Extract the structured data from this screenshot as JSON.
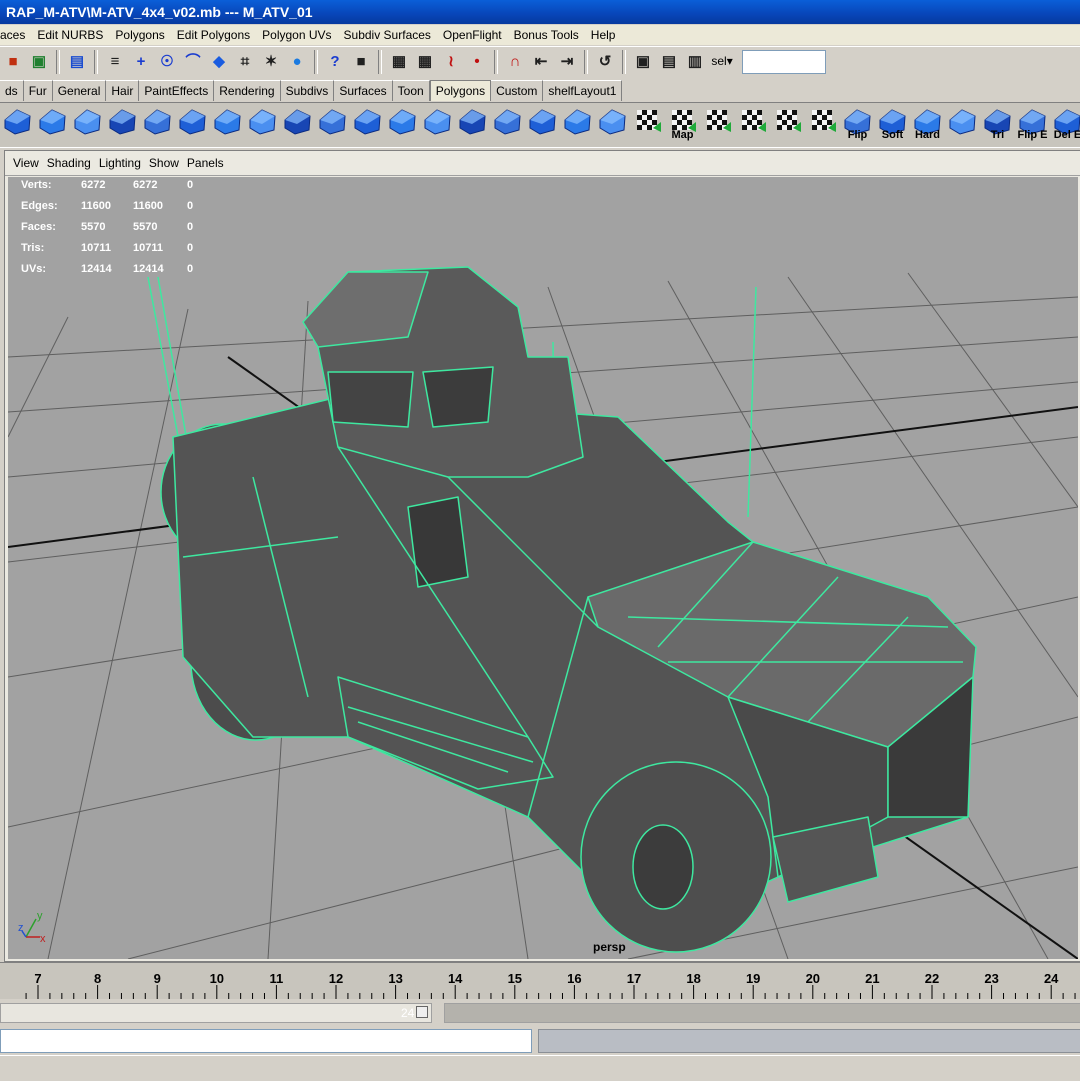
{
  "window": {
    "title": "RAP_M-ATV\\M-ATV_4x4_v02.mb   ---   M_ATV_01"
  },
  "menubar": {
    "items": [
      "aces",
      "Edit NURBS",
      "Polygons",
      "Edit Polygons",
      "Polygon UVs",
      "Subdiv Surfaces",
      "OpenFlight",
      "Bonus Tools",
      "Help"
    ]
  },
  "toolbar": {
    "icons": [
      "select-by-hierarchy-icon",
      "select-by-object-icon",
      "select-by-component-icon",
      "snap-menu-icon",
      "move-icon",
      "lasso-icon",
      "curve-icon",
      "cube-icon",
      "lattice-icon",
      "particle-icon",
      "sphere-icon",
      "help-icon",
      "lock-icon",
      "selection-mask-icon",
      "grid-snap-icon",
      "curve-snap-icon",
      "point-snap-icon",
      "magnet-snap-icon",
      "input-ops-icon",
      "output-ops-icon",
      "history-icon",
      "render-icon",
      "ipr-render-icon",
      "render-settings-icon"
    ],
    "sel_label": "sel",
    "sel_value": ""
  },
  "shelf_tabs": {
    "tabs": [
      "ds",
      "Fur",
      "General",
      "Hair",
      "PaintEffects",
      "Rendering",
      "Subdivs",
      "Surfaces",
      "Toon",
      "Polygons",
      "Custom",
      "shelfLayout1"
    ],
    "active": "Polygons"
  },
  "shelf": {
    "icons": [
      {
        "name": "poly-sphere-icon",
        "label": ""
      },
      {
        "name": "poly-cylinder-icon",
        "label": ""
      },
      {
        "name": "poly-cube-wire-icon",
        "label": ""
      },
      {
        "name": "extrude-face-icon",
        "label": ""
      },
      {
        "name": "split-polygon-icon",
        "label": ""
      },
      {
        "name": "extrude-edge-icon",
        "label": ""
      },
      {
        "name": "bevel-icon",
        "label": ""
      },
      {
        "name": "wedge-face-icon",
        "label": ""
      },
      {
        "name": "poke-face-icon",
        "label": ""
      },
      {
        "name": "append-polygon-icon",
        "label": ""
      },
      {
        "name": "merge-vertices-icon",
        "label": ""
      },
      {
        "name": "collapse-icon",
        "label": ""
      },
      {
        "name": "subdivide-icon",
        "label": ""
      },
      {
        "name": "smooth-icon",
        "label": ""
      },
      {
        "name": "combine-icon",
        "label": ""
      },
      {
        "name": "separate-icon",
        "label": ""
      },
      {
        "name": "triangulate-icon",
        "label": ""
      },
      {
        "name": "mirror-icon",
        "label": ""
      },
      {
        "name": "uv-planar-map-icon",
        "label": ""
      },
      {
        "name": "uv-texture-editor-icon",
        "label": "Map"
      },
      {
        "name": "uv-cylindrical-icon",
        "label": ""
      },
      {
        "name": "uv-spherical-icon",
        "label": ""
      },
      {
        "name": "uv-automatic-icon",
        "label": ""
      },
      {
        "name": "uv-layout-icon",
        "label": ""
      },
      {
        "name": "flip-normals-icon",
        "label": "Flip"
      },
      {
        "name": "soft-edge-icon",
        "label": "Soft"
      },
      {
        "name": "hard-edge-icon",
        "label": "Hard"
      },
      {
        "name": "normals-icon",
        "label": ""
      },
      {
        "name": "triangulate-face-icon",
        "label": "Tri"
      },
      {
        "name": "flip-edge-icon",
        "label": "Flip E"
      },
      {
        "name": "delete-edge-icon",
        "label": "Del E"
      },
      {
        "name": "quadrangulate-icon",
        "label": ""
      },
      {
        "name": "sculpt-icon",
        "label": ""
      },
      {
        "name": "checker-icon",
        "label": ""
      }
    ]
  },
  "panel_menu": {
    "items": [
      "View",
      "Shading",
      "Lighting",
      "Show",
      "Panels"
    ]
  },
  "hud": {
    "rows": [
      {
        "label": "Verts:",
        "total": "6272",
        "selected": "6272",
        "extra": "0"
      },
      {
        "label": "Edges:",
        "total": "11600",
        "selected": "11600",
        "extra": "0"
      },
      {
        "label": "Faces:",
        "total": "5570",
        "selected": "5570",
        "extra": "0"
      },
      {
        "label": "Tris:",
        "total": "10711",
        "selected": "10711",
        "extra": "0"
      },
      {
        "label": "UVs:",
        "total": "12414",
        "selected": "12414",
        "extra": "0"
      }
    ]
  },
  "viewport": {
    "camera_label": "persp",
    "axis_labels": [
      "y",
      "z",
      "x"
    ],
    "background": "#a2a2a2",
    "grid_color": "#000000",
    "wire_color": "#3ee8a0",
    "mesh_color": "#545454"
  },
  "time_slider": {
    "ticks": [
      "7",
      "8",
      "9",
      "10",
      "11",
      "12",
      "13",
      "14",
      "15",
      "16",
      "17",
      "18",
      "19",
      "20",
      "21",
      "22",
      "23",
      "24"
    ]
  },
  "range_slider": {
    "end_value": "24"
  },
  "command_line": {
    "input_value": "",
    "result_value": ""
  }
}
